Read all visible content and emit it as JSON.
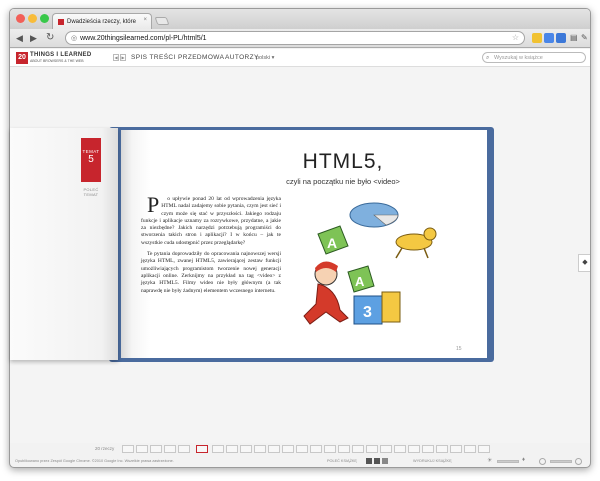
{
  "browser": {
    "tab_title": "Dwadzieścia rzeczy, które",
    "url": "www.20thingsilearned.com/pl-PL/html5/1"
  },
  "site": {
    "logo_number": "20",
    "logo_title": "THINGS I LEARNED",
    "logo_subtitle": "ABOUT BROWSERS & THE WEB",
    "nav": [
      "SPIS TREŚCI",
      "PRZEDMOWA",
      "AUTORZY"
    ],
    "language": "polski ▾",
    "search_placeholder": "Wyszukaj w książce"
  },
  "book": {
    "chapter_label": "TEMAT",
    "chapter_number": "5",
    "share_label": "POLEĆ\nTEMAT",
    "title": "HTML5,",
    "subtitle": "czyli na początku nie było <video>",
    "drop_cap": "P",
    "paragraph1": "o upływie ponad 20 lat od wprowadzenia języka HTML nadal zadajemy sobie pytania, czym jest sieć i czym może się stać w przyszłości. Jakiego rodzaju funkcje i aplikacje uznamy za rozrywkowe, przydatne, a jakie za niezbędne? Jakich narzędzi potrzebują programiści do stworzenia takich stron i aplikacji? I w końcu – jak te wszystkie cuda udostępnić przez przeglądarkę?",
    "paragraph2": "Te pytania doprowadziły do opracowania najnowszej wersji języka HTML, zwanej HTML5, zawierającej zestaw funkcji umożliwiających programistom tworzenie nowej generacji aplikacji online. Zerknijmy na przykład na tag <video> z języka HTML5. Filmy wideo nie były głównym (a tak naprawdę nie były żadnym) elementem wczesnego internetu.",
    "page_number": "15"
  },
  "bottom": {
    "pages_label": "20 rzeczy",
    "footer_left": "Opublikowano przez Zespół Google Chrome. ©2010 Google Inc. Wszelkie prawa zastrzeżone.",
    "share_book": "POLEĆ KSIĄŻKĘ",
    "print_book": "WYDRUKUJ KSIĄŻKĘ"
  },
  "colors": {
    "accent": "#c7252d",
    "book_cover": "#4a6b9e"
  }
}
